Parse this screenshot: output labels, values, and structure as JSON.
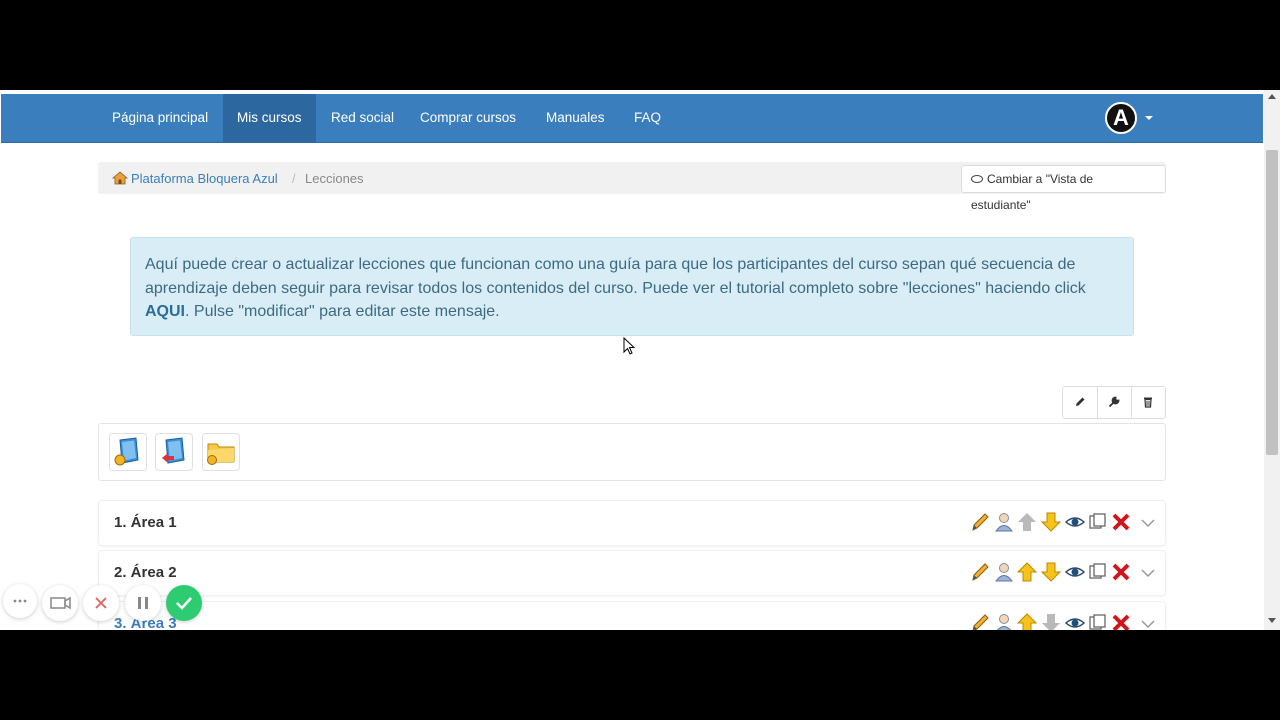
{
  "nav": {
    "items": [
      {
        "label": "Página principal",
        "active": false
      },
      {
        "label": "Mis cursos",
        "active": true
      },
      {
        "label": "Red social",
        "active": false
      },
      {
        "label": "Comprar cursos",
        "active": false
      },
      {
        "label": "Manuales",
        "active": false
      },
      {
        "label": "FAQ",
        "active": false
      }
    ],
    "avatar_letter": "A",
    "color": "#3a7ebd"
  },
  "breadcrumb": {
    "home_label": "Plataforma Bloquera Azul",
    "separator": "/",
    "current": "Lecciones"
  },
  "student_view_button": "Cambiar a \"Vista de estudiante\"",
  "info": {
    "text_before": "Aquí puede crear o actualizar lecciones que funcionan como una guía para que los participantes del curso sepan qué secuencia de aprendizaje deben seguir para revisar todos los contenidos del curso. Puede ver el tutorial completo sobre \"lecciones\" haciendo click ",
    "link_text": "AQUI",
    "text_after": ". Pulse \"modificar\" para editar este mensaje."
  },
  "toolbar_icons": [
    "pencil-icon",
    "wrench-icon",
    "trash-icon"
  ],
  "panel_icons": [
    "new-lesson-icon",
    "import-lesson-icon",
    "new-folder-icon"
  ],
  "lessons": [
    {
      "title": "1. Área 1",
      "up_enabled": false,
      "down_enabled": true
    },
    {
      "title": "2. Área 2",
      "up_enabled": true,
      "down_enabled": true
    },
    {
      "title": "3. Área 3",
      "up_enabled": true,
      "down_enabled": false
    }
  ]
}
